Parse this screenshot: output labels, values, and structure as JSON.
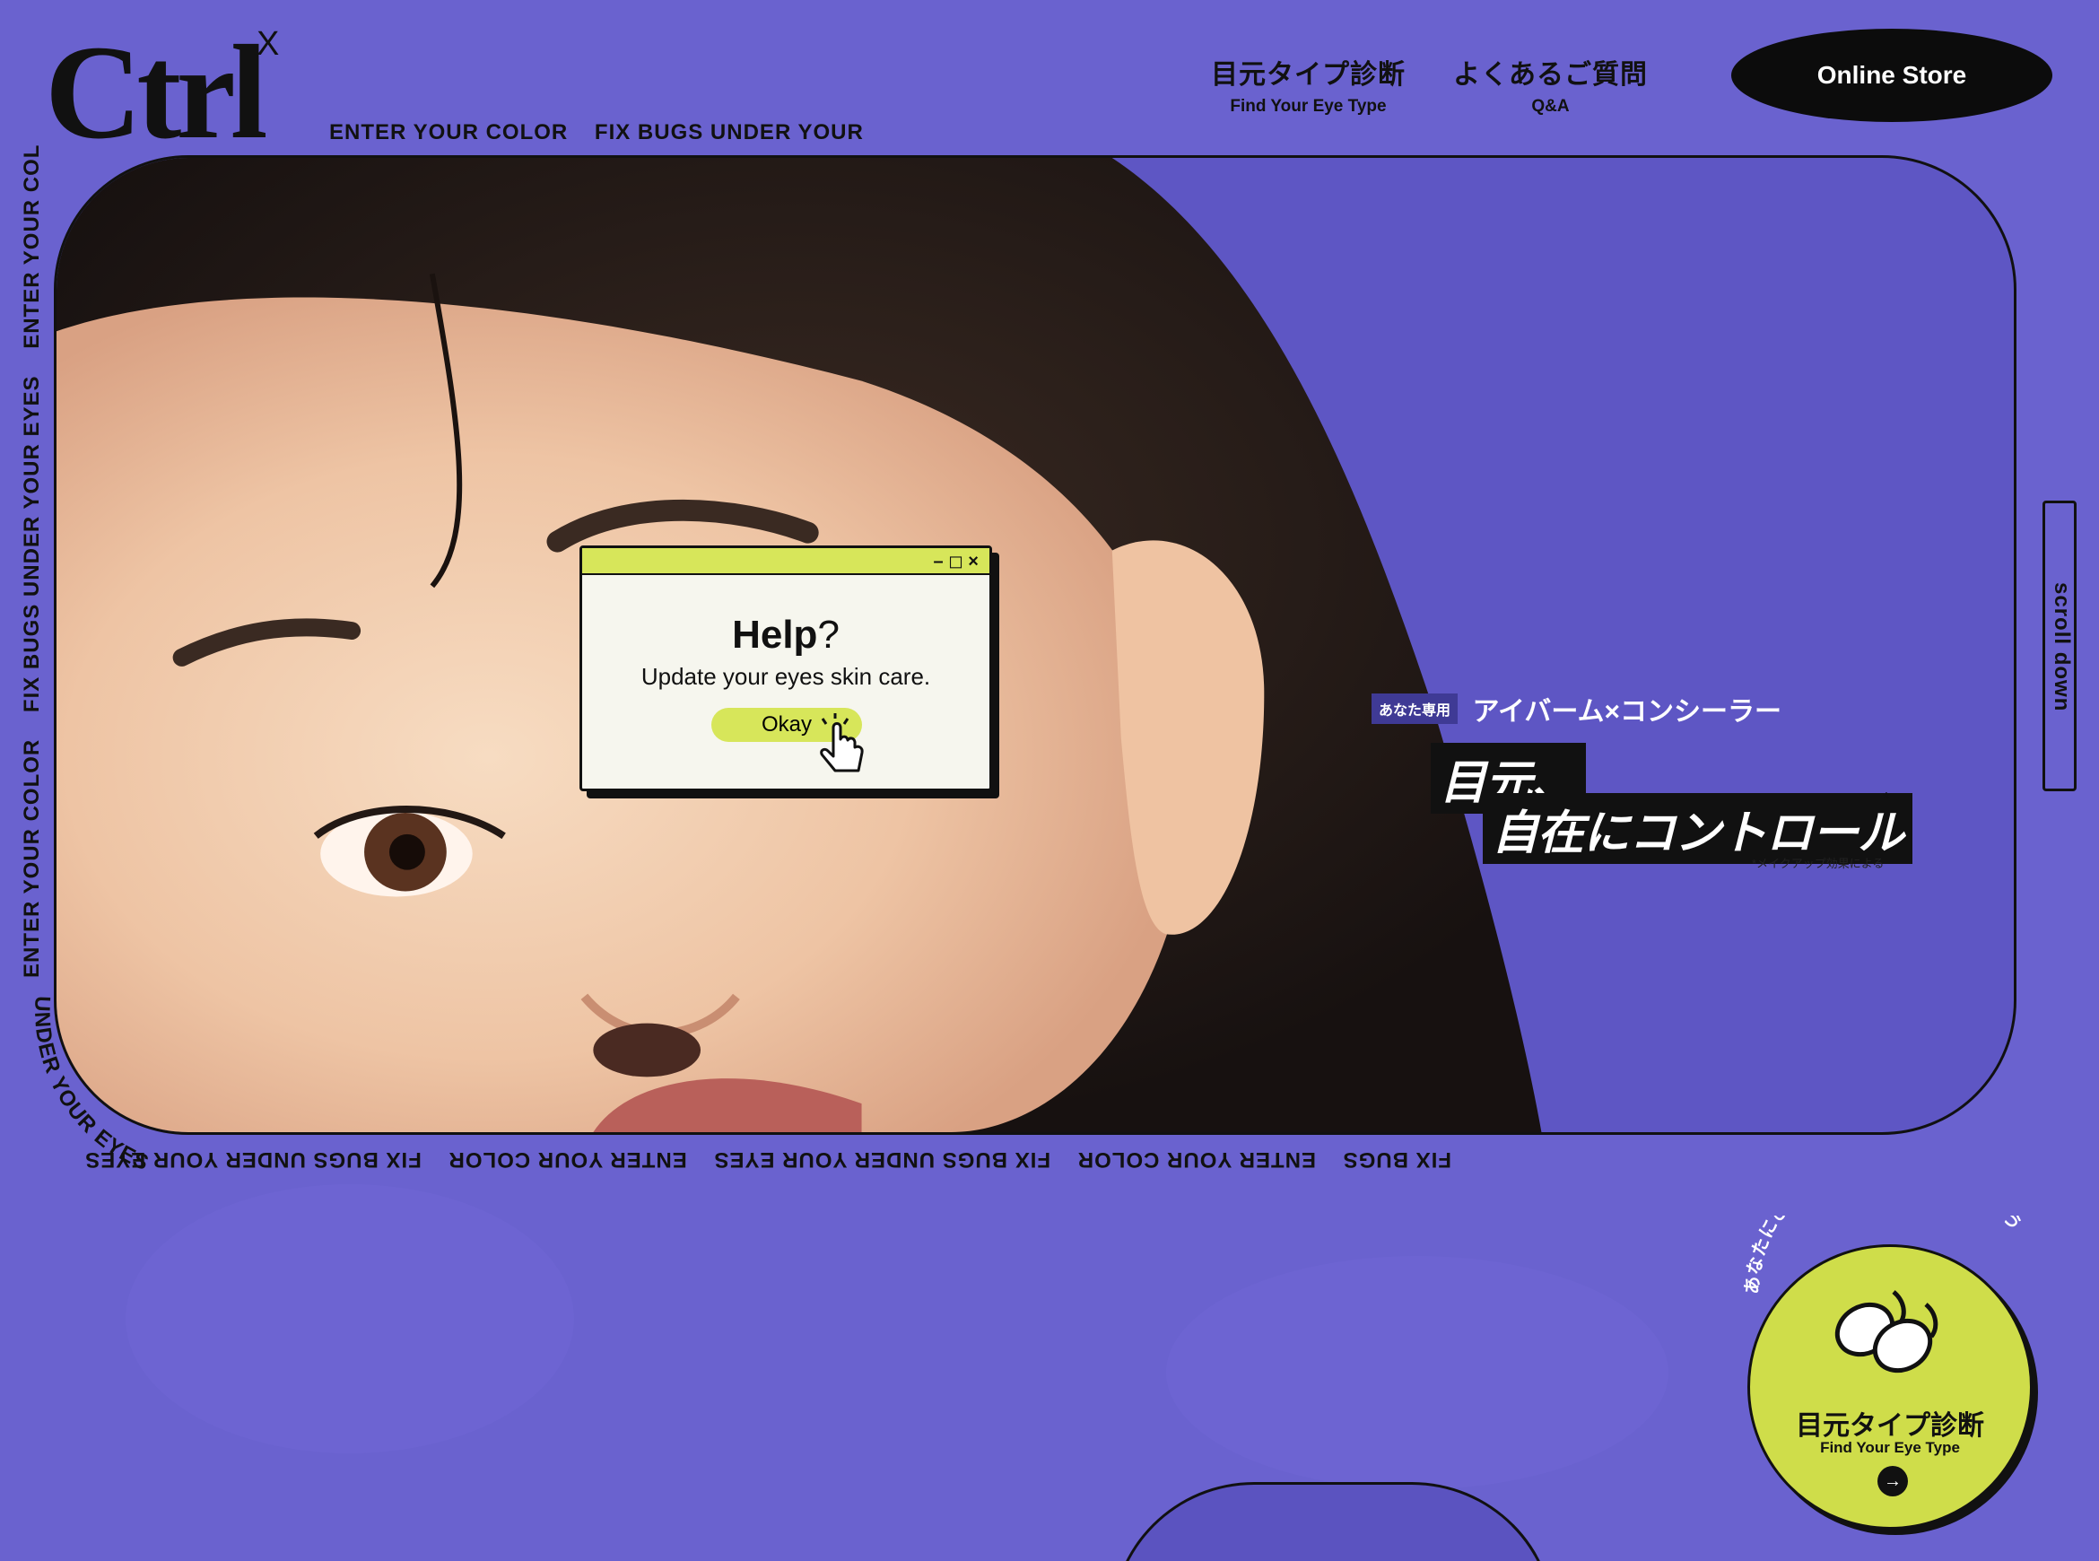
{
  "brand": {
    "logo": "Ctrl",
    "logo_sup": "X"
  },
  "tagline": [
    "ENTER YOUR COLOR",
    "FIX BUGS UNDER YOUR"
  ],
  "nav": [
    {
      "jp": "目元タイプ診断",
      "en": "Find Your Eye Type"
    },
    {
      "jp": "よくあるご質問",
      "en": "Q&A"
    }
  ],
  "store_button": "Online Store",
  "side_text": [
    "ENTER YOUR COLOR",
    "FIX BUGS UNDER YOUR EYES",
    "ENTER YOUR COL"
  ],
  "curve_text": "UNDER YOUR EYES",
  "bottom_text": [
    "FIX BUGS",
    "ENTER YOUR COLOR",
    "FIX BUGS UNDER YOUR EYES",
    "ENTER YOUR COLOR",
    "FIX BUGS UNDER YOUR EYES"
  ],
  "popup": {
    "controls": "– ◻ ×",
    "title": "Help",
    "title_mark": "?",
    "text": "Update your eyes skin care.",
    "button": "Okay"
  },
  "copy": {
    "badge": "あなた専用",
    "product": "アイバーム×コンシーラー",
    "headline_1": "目元、",
    "headline_2": "自在にコントロール",
    "asterisk": "*",
    "footnote": "*メイクアップ効果による"
  },
  "scroll_label": "scroll down",
  "diagnosis": {
    "arc": "あなたにぴったりの目元ケアを見つけよう",
    "jp": "目元タイプ診断",
    "en": "Find Your Eye Type",
    "arrow": "→"
  },
  "colors": {
    "background": "#6a62cf",
    "accent": "#d7e65a",
    "dark": "#111111"
  }
}
